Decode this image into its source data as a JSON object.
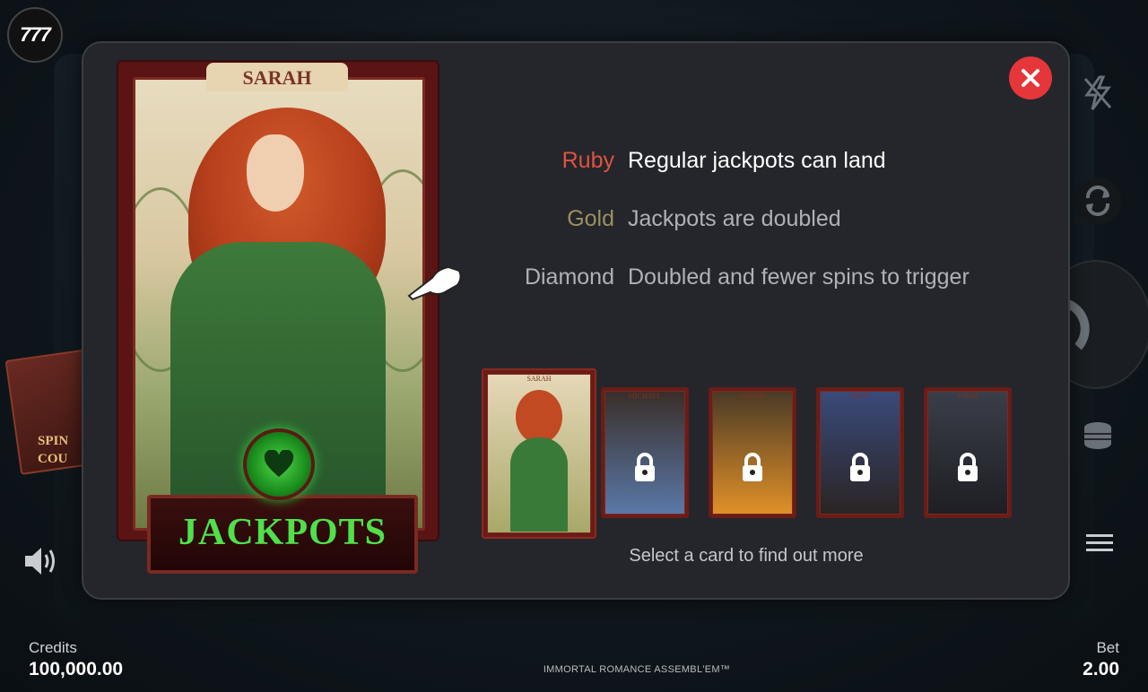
{
  "app": {
    "logo_text": "777",
    "game_title": "IMMORTAL ROMANCE ASSEMBL'EM™"
  },
  "background": {
    "card_text_line1": "SPIN",
    "card_text_line2": "COU"
  },
  "footer": {
    "credits_label": "Credits",
    "credits_value": "100,000.00",
    "bet_label": "Bet",
    "bet_value": "2.00"
  },
  "modal": {
    "featured_card": {
      "name": "SARAH",
      "feature_label": "JACKPOTS",
      "feature_icon": "heart-icon"
    },
    "tiers": [
      {
        "label": "Ruby",
        "description": "Regular jackpots can land",
        "color": "#e05240"
      },
      {
        "label": "Gold",
        "description": "Jackpots are doubled",
        "color": "#9e8f5e"
      },
      {
        "label": "Diamond",
        "description": "Doubled and fewer spins to trigger",
        "color": "#aeb2b6"
      }
    ],
    "cards": [
      {
        "name": "SARAH",
        "locked": false,
        "selected": true
      },
      {
        "name": "MICHAEL",
        "locked": true,
        "selected": false
      },
      {
        "name": "AMBER",
        "locked": true,
        "selected": false
      },
      {
        "name": "TROY",
        "locked": true,
        "selected": false
      },
      {
        "name": "VARIK",
        "locked": true,
        "selected": false
      }
    ],
    "helper_text": "Select a card to find out more"
  },
  "side_controls": [
    "lightning-icon",
    "autoplay-icon",
    "spin-icon",
    "coins-icon",
    "menu-icon",
    "sound-icon"
  ],
  "colors": {
    "close": "#e5363a",
    "jackpot_green": "#4fe04a",
    "modal_bg": "#24262b"
  }
}
